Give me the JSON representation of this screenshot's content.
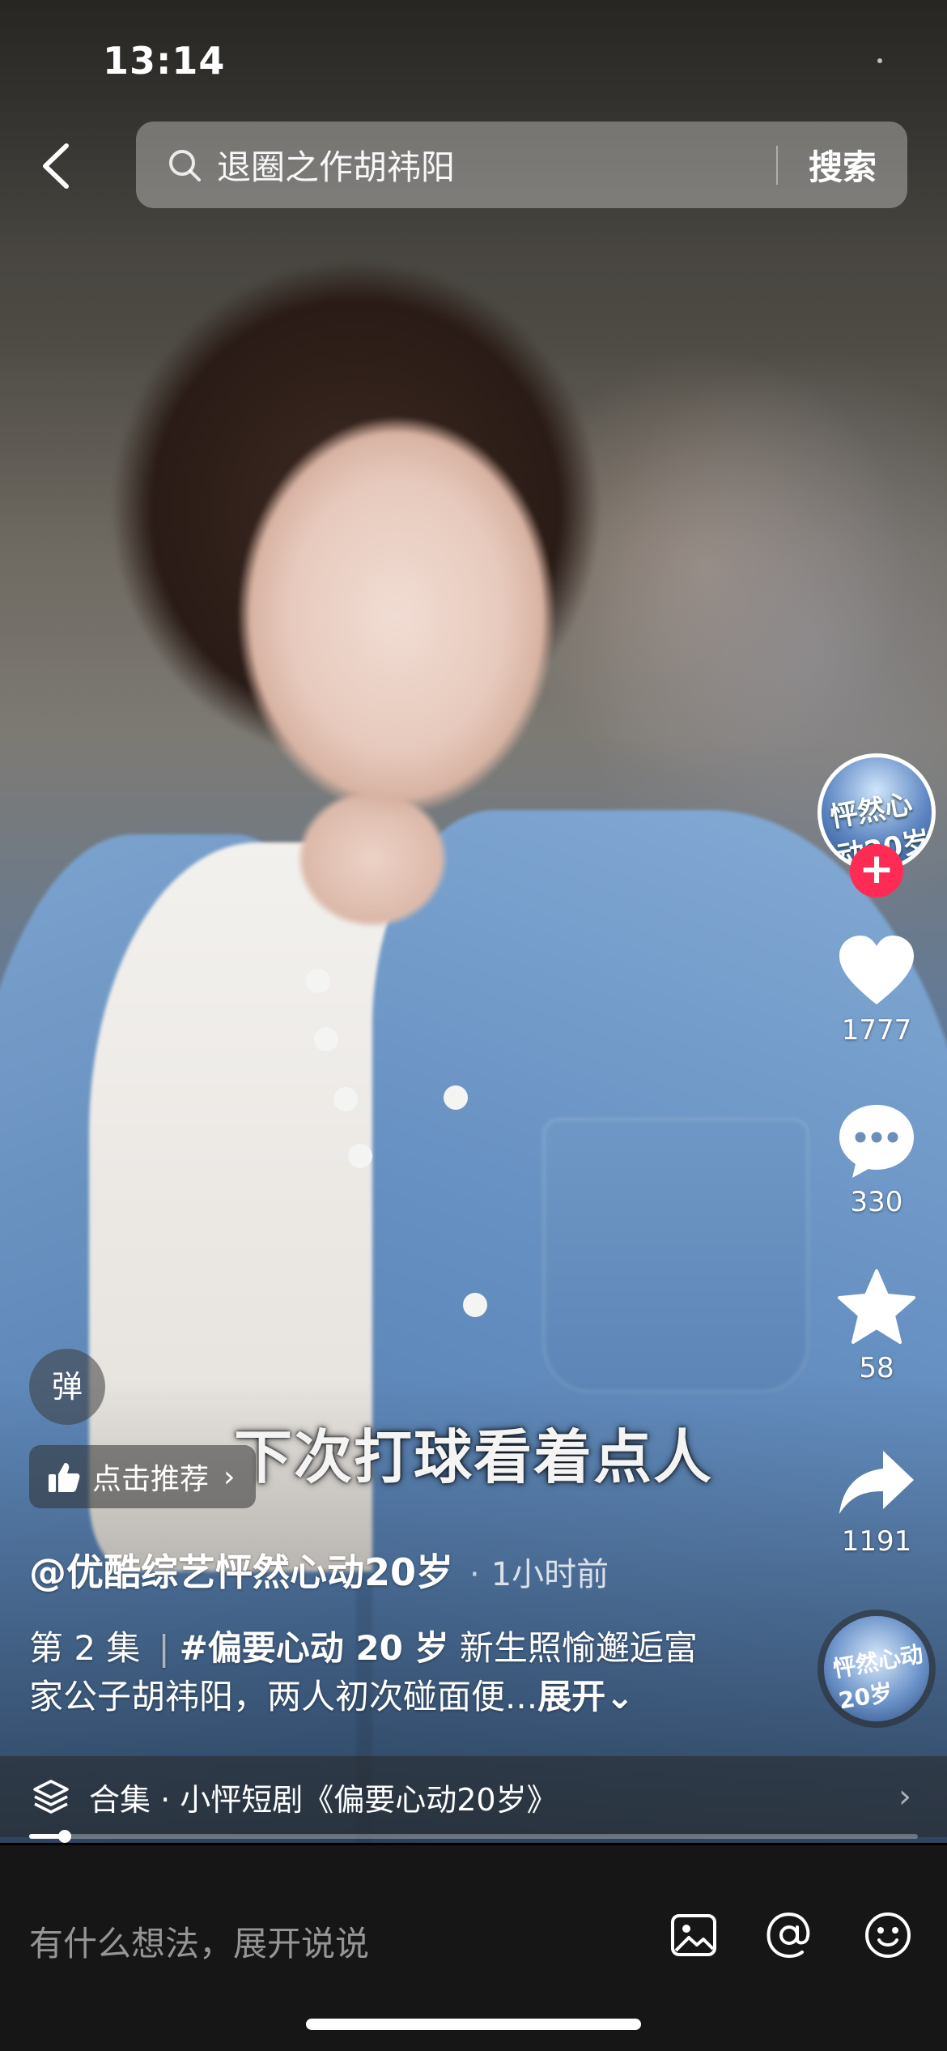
{
  "status_bar": {
    "time": "13:14"
  },
  "search": {
    "query": "退圈之作胡祎阳",
    "submit_label": "搜索"
  },
  "right_rail": {
    "avatar_text": "怦然心动20岁",
    "follow_symbol": "+",
    "likes": "1777",
    "comments": "330",
    "favorites": "58",
    "shares": "1191",
    "disc_text": "怦然心动20岁"
  },
  "overlay": {
    "danmu_label": "弹",
    "subtitle": "下次打球看着点人",
    "recommend_label": "点击推荐",
    "recommend_chevron": "›"
  },
  "post": {
    "author": "@优酷综艺怦然心动20岁",
    "time": "1小时前",
    "episode": "第 2 集",
    "separator": "|",
    "hashtag": "#偏要心动 20 岁",
    "description": " 新生照愉邂逅富家公子胡祎阳，两人初次碰面便...",
    "expand_label": "展开⌄"
  },
  "collection": {
    "label": "合集 · 小怦短剧《偏要心动20岁》",
    "chevron": "›"
  },
  "playback": {
    "progress": 0.04
  },
  "comment_bar": {
    "placeholder": "有什么想法，展开说说"
  },
  "colors": {
    "follow_red": "#fe2c55",
    "bar_bg": "#161616"
  }
}
